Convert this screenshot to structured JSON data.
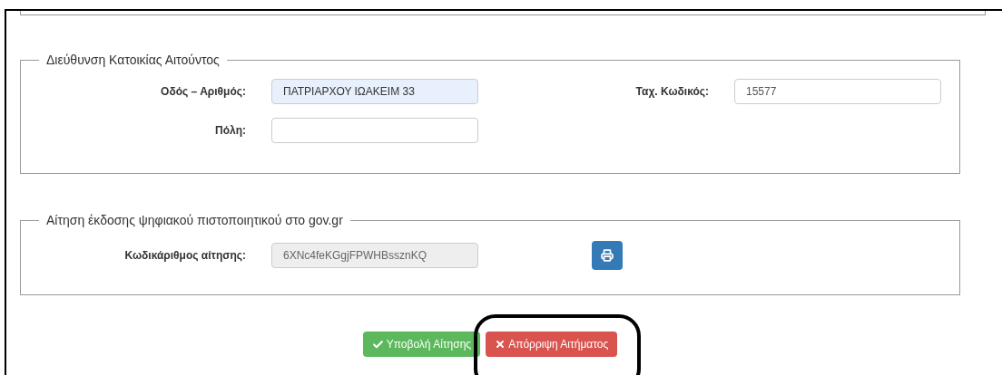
{
  "sections": [
    {
      "legend": "Διεύθυνση Κατοικίας Αιτούντος",
      "rows": [
        [
          {
            "label": "Οδός – Αριθμός:",
            "value": "ΠΑΤΡΙΑΡΧΟΥ ΙΩΑΚΕΙΜ 33",
            "kind": "autofilled"
          },
          {
            "label": "Ταχ. Κωδικός:",
            "value": "15577",
            "kind": "normal"
          }
        ],
        [
          {
            "label": "Πόλη:",
            "kind": "normal"
          }
        ]
      ]
    },
    {
      "legend": "Αίτηση έκδοσης ψηφιακού πιστοποιητικού στο gov.gr",
      "rows": [
        [
          {
            "label": "Κωδικάριθμος αίτησης:",
            "value": "6XNc4feKGgjFPWHBssznKQ",
            "kind": "readonly",
            "print_button": true
          }
        ]
      ]
    }
  ],
  "buttons": [
    {
      "kind": "submit",
      "label": "Υποβολή Αίτησης",
      "highlighted": false
    },
    {
      "kind": "reject",
      "label": "Απόρριψη Αιτήματος",
      "highlighted": true
    }
  ]
}
